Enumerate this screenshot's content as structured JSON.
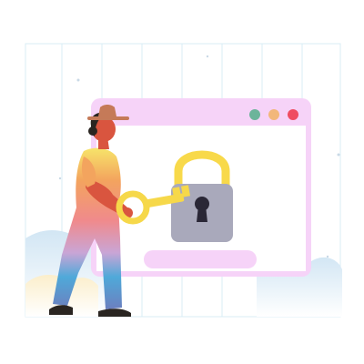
{
  "illustration": {
    "description_icon": "person-unlocking-padlock-with-key",
    "window_dots": [
      "green-dot",
      "orange-dot",
      "red-dot"
    ],
    "colors": {
      "window_header": "#f6d3f8",
      "window_body": "#ffffff",
      "window_border": "#f1c2f2",
      "dot_green": "#6cb49a",
      "dot_orange": "#f2b77a",
      "dot_red": "#ef4d62",
      "padlock_body": "#a9a9bb",
      "padlock_shackle": "#f8d94a",
      "key": "#f6d84a",
      "input_bar": "#f6d3f8",
      "grid_lines": "#d9ecf5",
      "ground_cloud": "#d6e8f4",
      "skin": "#d9553f",
      "hat": "#c57a58",
      "hair": "#2a2521"
    }
  }
}
